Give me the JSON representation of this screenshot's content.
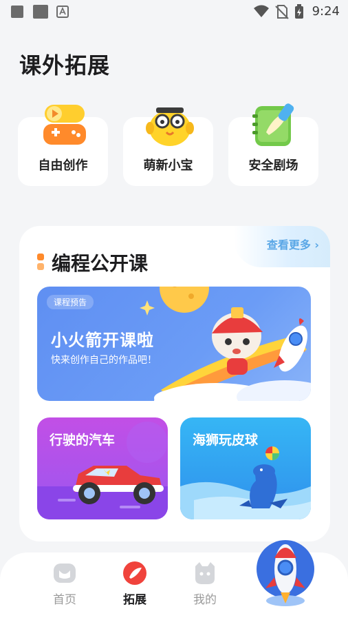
{
  "status_bar": {
    "time": "9:24"
  },
  "header": {
    "title": "课外拓展"
  },
  "quick_entries": [
    {
      "label": "自由创作",
      "icon": "game-controller-icon"
    },
    {
      "label": "萌新小宝",
      "icon": "cartoon-character-icon"
    },
    {
      "label": "安全剧场",
      "icon": "notebook-brush-icon"
    }
  ],
  "courses": {
    "section_title": "编程公开课",
    "see_more": "查看更多",
    "banner": {
      "tag": "课程预告",
      "title": "小火箭开课啦",
      "subtitle": "快来创作自己的作品吧！"
    },
    "cards": [
      {
        "title": "行驶的汽车"
      },
      {
        "title": "海狮玩皮球"
      }
    ]
  },
  "tabbar": {
    "tabs": [
      {
        "label": "首页"
      },
      {
        "label": "拓展"
      },
      {
        "label": "我的"
      }
    ],
    "active": "拓展"
  },
  "colors": {
    "accent_orange": "#ff8a2b",
    "banner_blue": "#6b9cf6",
    "card_purple": "#a35ef0",
    "card_blue": "#35a6f2",
    "active_tab": "#f0433c"
  }
}
